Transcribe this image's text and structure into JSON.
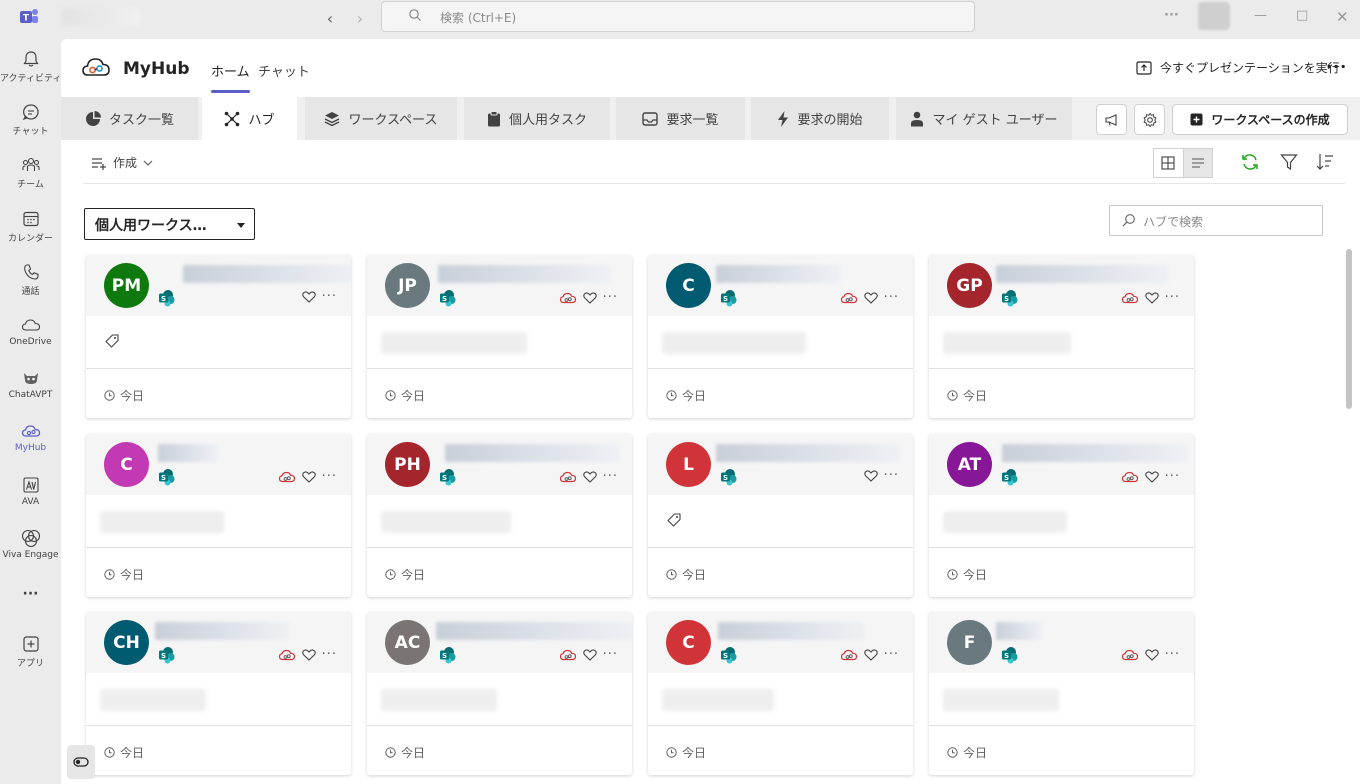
{
  "titlebar": {
    "search_placeholder": "検索 (Ctrl+E)",
    "more": "···"
  },
  "rail": [
    {
      "label": "アクティビティ",
      "icon": "bell-icon"
    },
    {
      "label": "チャット",
      "icon": "chat-icon"
    },
    {
      "label": "チーム",
      "icon": "teams-icon"
    },
    {
      "label": "カレンダー",
      "icon": "calendar-icon"
    },
    {
      "label": "通話",
      "icon": "phone-icon"
    },
    {
      "label": "OneDrive",
      "icon": "cloud-icon"
    },
    {
      "label": "ChatAVPT",
      "icon": "bot-icon"
    },
    {
      "label": "MyHub",
      "icon": "myhub-icon"
    },
    {
      "label": "AVA",
      "icon": "ava-icon"
    },
    {
      "label": "Viva Engage",
      "icon": "viva-engage-icon"
    },
    {
      "label": "···",
      "icon": "more-icon"
    },
    {
      "label": "アプリ",
      "icon": "add-app-icon"
    }
  ],
  "app": {
    "title": "MyHub",
    "top_tabs": [
      "ホーム",
      "チャット"
    ],
    "present_label": "今すぐプレゼンテーションを実行",
    "more": "···"
  },
  "tabs": [
    {
      "label": "タスク一覧",
      "icon": "pie-chart-icon"
    },
    {
      "label": "ハブ",
      "icon": "hub-icon",
      "active": true
    },
    {
      "label": "ワークスペース",
      "icon": "layers-icon"
    },
    {
      "label": "個人用タスク",
      "icon": "clipboard-icon"
    },
    {
      "label": "要求一覧",
      "icon": "inbox-icon"
    },
    {
      "label": "要求の開始",
      "icon": "bolt-icon"
    },
    {
      "label": "マイ ゲスト ユーザー",
      "icon": "person-icon"
    }
  ],
  "create_workspace_label": "ワークスペースの作成",
  "toolbar": {
    "create_label": "作成"
  },
  "scope_dropdown": {
    "value": "個人用ワークス…"
  },
  "hub_search": {
    "placeholder": "ハブで検索"
  },
  "cards": [
    {
      "initials": "PM",
      "color": "#0e7a0d",
      "cloud": false,
      "tag": true,
      "date": "今日"
    },
    {
      "initials": "JP",
      "color": "#69797e",
      "cloud": true,
      "tag": false,
      "date": "今日"
    },
    {
      "initials": "C",
      "color": "#005b70",
      "cloud": true,
      "tag": false,
      "date": "今日"
    },
    {
      "initials": "GP",
      "color": "#a4262c",
      "cloud": true,
      "tag": false,
      "date": "今日"
    },
    {
      "initials": "C",
      "color": "#c239b3",
      "cloud": true,
      "tag": false,
      "date": "今日"
    },
    {
      "initials": "PH",
      "color": "#a4262c",
      "cloud": true,
      "tag": false,
      "date": "今日"
    },
    {
      "initials": "L",
      "color": "#d13438",
      "cloud": false,
      "tag": true,
      "date": "今日"
    },
    {
      "initials": "AT",
      "color": "#881798",
      "cloud": true,
      "tag": false,
      "date": "今日"
    },
    {
      "initials": "CH",
      "color": "#005b70",
      "cloud": true,
      "tag": false,
      "date": "今日"
    },
    {
      "initials": "AC",
      "color": "#7a7574",
      "cloud": true,
      "tag": false,
      "date": "今日"
    },
    {
      "initials": "C",
      "color": "#d13438",
      "cloud": true,
      "tag": false,
      "date": "今日"
    },
    {
      "initials": "F",
      "color": "#69797e",
      "cloud": true,
      "tag": false,
      "date": "今日"
    }
  ]
}
